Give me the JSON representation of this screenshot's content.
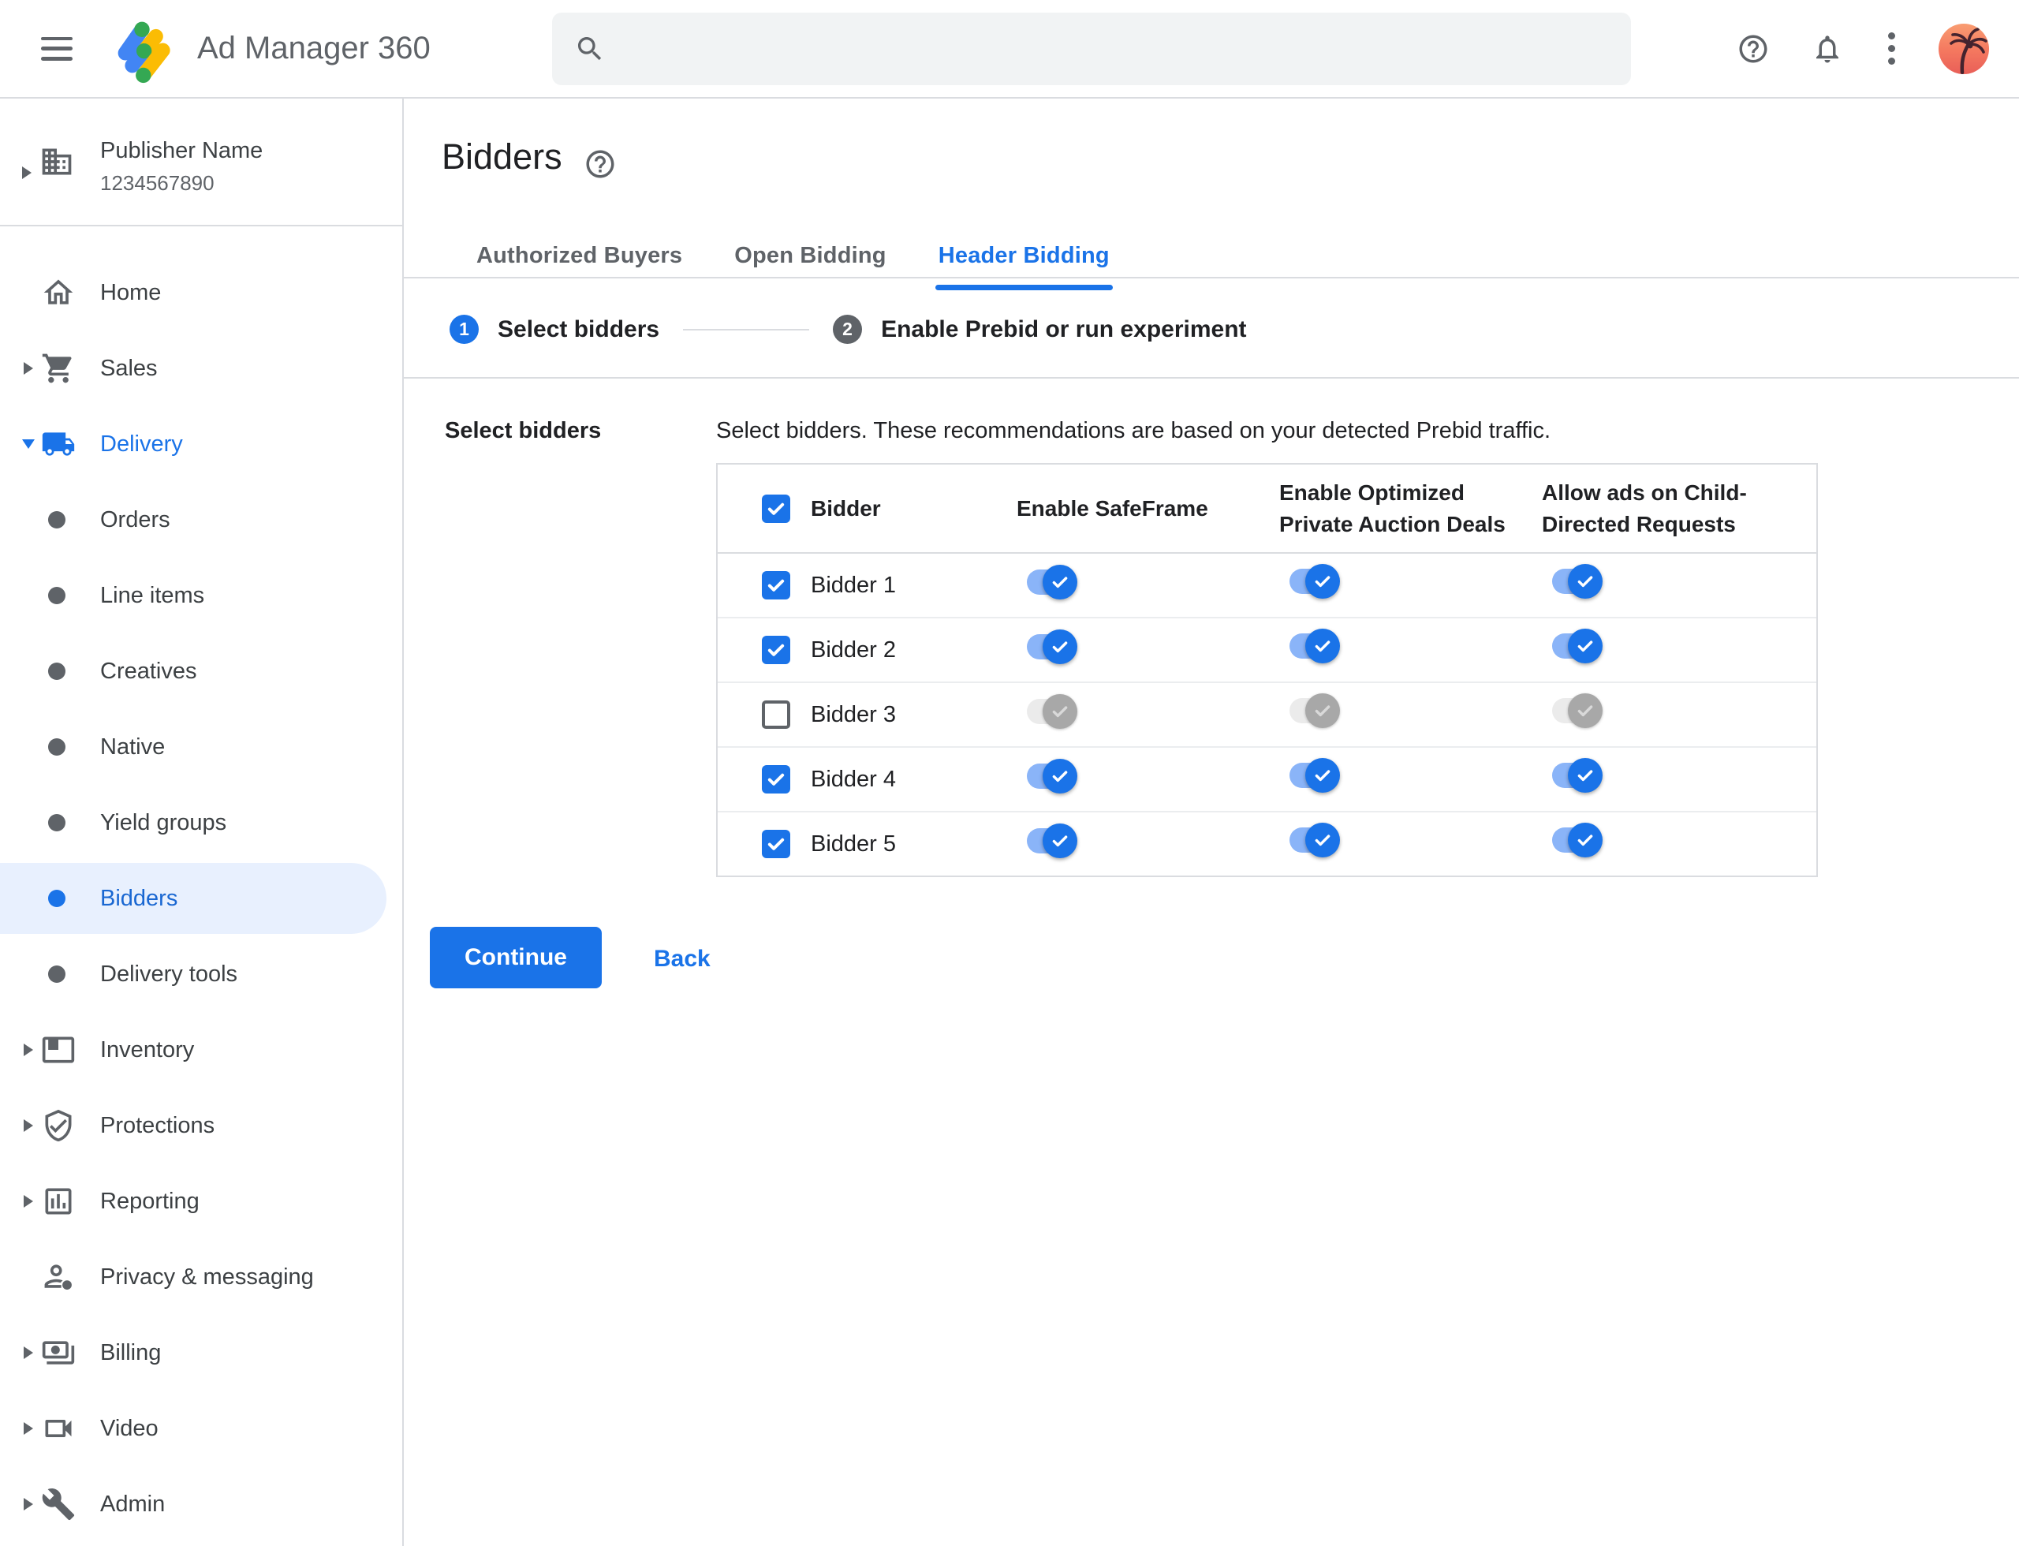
{
  "topbar": {
    "app_name": "Ad Manager 360",
    "search_value": ""
  },
  "sidebar": {
    "publisher": {
      "name": "Publisher Name",
      "id": "1234567890"
    },
    "items": [
      {
        "label": "Home"
      },
      {
        "label": "Sales"
      },
      {
        "label": "Delivery",
        "expanded": true
      },
      {
        "label": "Orders"
      },
      {
        "label": "Line items"
      },
      {
        "label": "Creatives"
      },
      {
        "label": "Native"
      },
      {
        "label": "Yield groups"
      },
      {
        "label": "Bidders",
        "selected": true
      },
      {
        "label": "Delivery tools"
      },
      {
        "label": "Inventory"
      },
      {
        "label": "Protections"
      },
      {
        "label": "Reporting"
      },
      {
        "label": "Privacy & messaging"
      },
      {
        "label": "Billing"
      },
      {
        "label": "Video"
      },
      {
        "label": "Admin"
      }
    ]
  },
  "main": {
    "title": "Bidders",
    "tabs": [
      {
        "label": "Authorized Buyers",
        "active": false
      },
      {
        "label": "Open Bidding",
        "active": false
      },
      {
        "label": "Header Bidding",
        "active": true
      }
    ],
    "steps": [
      {
        "number": "1",
        "label": "Select bidders",
        "active": true
      },
      {
        "number": "2",
        "label": "Enable Prebid or run experiment",
        "active": false
      }
    ],
    "section_label": "Select bidders",
    "description": "Select bidders. These recommendations are based on your detected Prebid traffic.",
    "table": {
      "columns": [
        "Bidder",
        "Enable SafeFrame",
        "Enable Optimized Private Auction Deals",
        "Allow ads on Child-Directed Requests"
      ],
      "select_all_checked": true,
      "rows": [
        {
          "name": "Bidder 1",
          "checked": true,
          "safeframe": true,
          "optimized_private_auction": true,
          "child_directed": true
        },
        {
          "name": "Bidder 2",
          "checked": true,
          "safeframe": true,
          "optimized_private_auction": true,
          "child_directed": true
        },
        {
          "name": "Bidder 3",
          "checked": false,
          "safeframe": false,
          "optimized_private_auction": false,
          "child_directed": false
        },
        {
          "name": "Bidder 4",
          "checked": true,
          "safeframe": true,
          "optimized_private_auction": true,
          "child_directed": true
        },
        {
          "name": "Bidder 5",
          "checked": true,
          "safeframe": true,
          "optimized_private_auction": true,
          "child_directed": true
        }
      ]
    },
    "actions": {
      "continue": "Continue",
      "back": "Back"
    }
  },
  "colors": {
    "accent_blue": "#1a73e8",
    "selected_item_bg": "#e8f0fe",
    "selected_item_text": "#1967d2",
    "toggle_track_on": "#8ab4f8",
    "toggle_thumb_off": "#a8a8a8",
    "divider": "#dadce0",
    "text_primary": "#202124",
    "text_secondary": "#5f6368",
    "search_bg": "#f1f3f4",
    "logo_blue": "#4285f4",
    "logo_yellow": "#fbbc04",
    "logo_green": "#34a853"
  }
}
